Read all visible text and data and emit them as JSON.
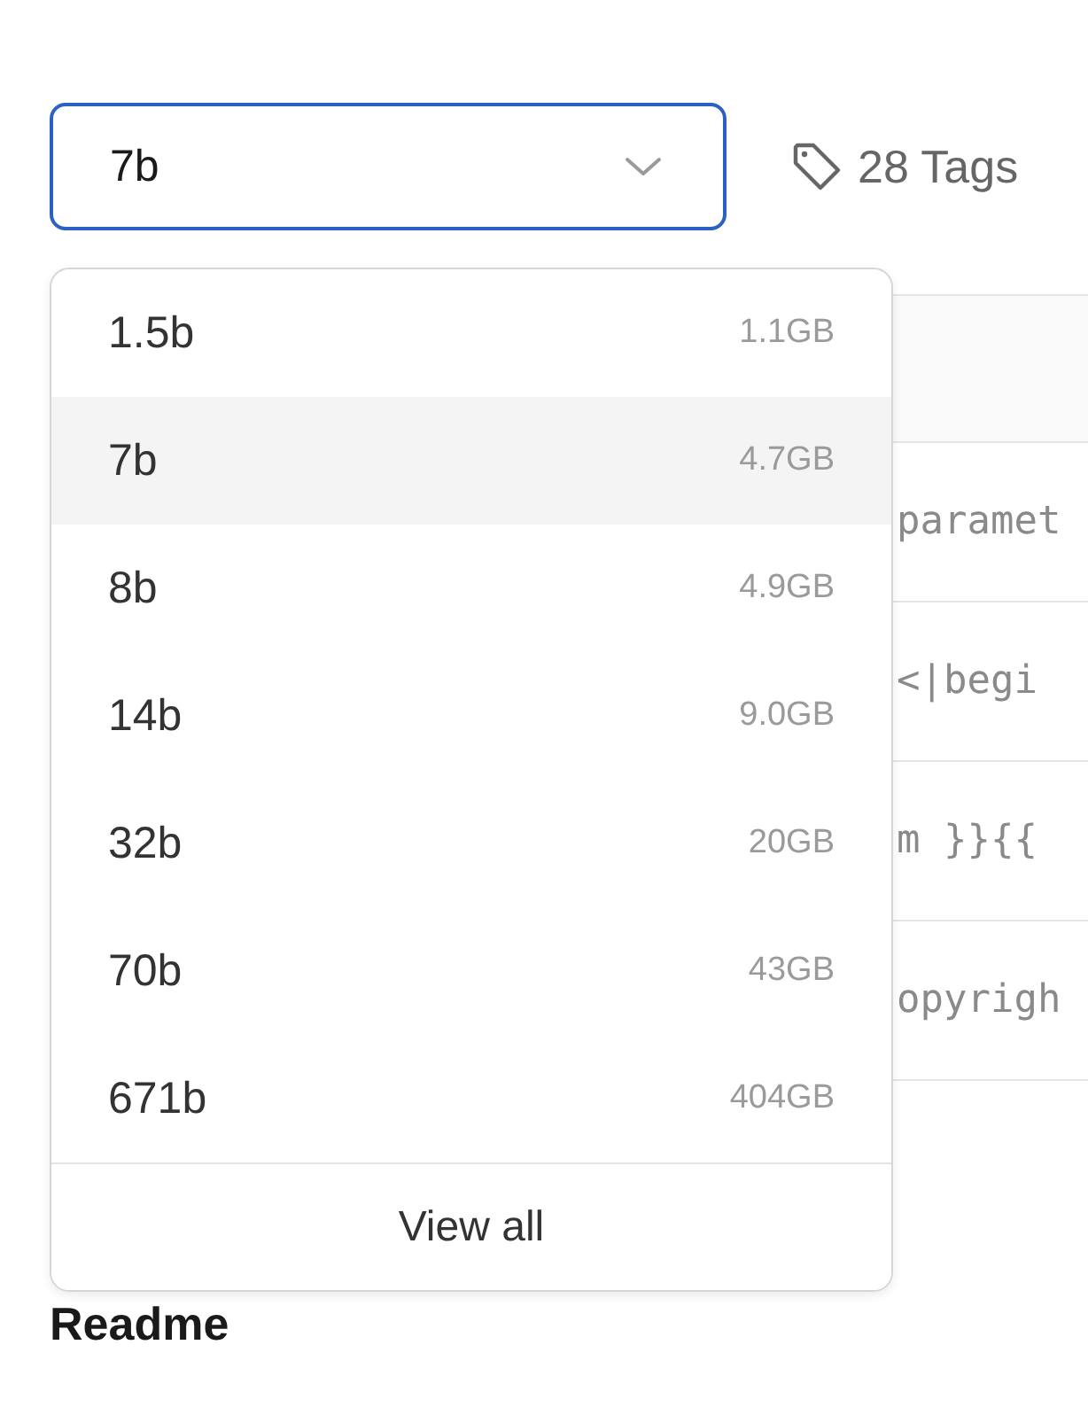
{
  "model_select": {
    "value": "7b",
    "expanded": true
  },
  "tags_link": {
    "label": "28 Tags"
  },
  "table": {
    "rows": [
      {
        "cell": "paramet"
      },
      {
        "cell": "<|begi"
      },
      {
        "cell": "m }}{{"
      },
      {
        "cell": "opyrigh"
      }
    ]
  },
  "dropdown": {
    "options": [
      {
        "label": "1.5b",
        "size": "1.1GB",
        "selected": false
      },
      {
        "label": "7b",
        "size": "4.7GB",
        "selected": true
      },
      {
        "label": "8b",
        "size": "4.9GB",
        "selected": false
      },
      {
        "label": "14b",
        "size": "9.0GB",
        "selected": false
      },
      {
        "label": "32b",
        "size": "20GB",
        "selected": false
      },
      {
        "label": "70b",
        "size": "43GB",
        "selected": false
      },
      {
        "label": "671b",
        "size": "404GB",
        "selected": false
      }
    ],
    "footer": "View all"
  },
  "readme": {
    "title": "Readme"
  }
}
